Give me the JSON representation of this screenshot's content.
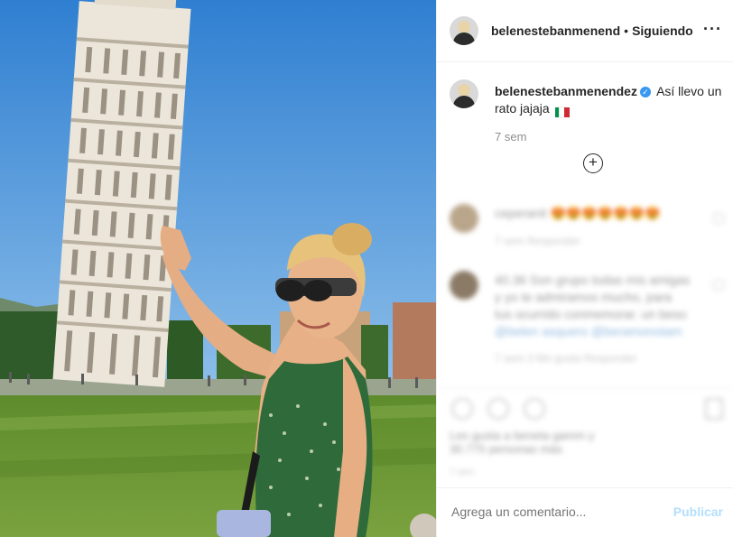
{
  "post": {
    "username_header": "belenestebanmenend",
    "dot": "•",
    "follow_label": "Siguiendo",
    "more_label": "···",
    "caption_username": "belenestebanmenendez",
    "verified_mark": "✓",
    "caption_text": "Así llevo un rato jajaja",
    "caption_flag": "Italy flag",
    "time_ago": "7 sem",
    "load_more_icon": "plus-circle-icon"
  },
  "comments_blurred": [
    {
      "line1": "ceperanit 😍😍😍😍😍😍😍",
      "meta": "7 sem   Responder"
    },
    {
      "line1": "40.36 Son grupo todas mis amigas",
      "line2": "y yo te admiramos mucho, para",
      "line3": "tus ocurrido conmemorar. un beso",
      "line4": "@belen asquero @beramonotam",
      "meta": "7 sem   3 Me gusta   Responder"
    }
  ],
  "likes_blurred": {
    "line1": "Les gusta a beneta gamm y",
    "line2": "30.775 personas más",
    "ago": "7 sem"
  },
  "add_comment": {
    "placeholder": "Agrega un comentario...",
    "publish_label": "Publicar"
  },
  "colors": {
    "verified": "#3897f0",
    "publish": "#b2dffc",
    "flag_green": "#009246",
    "flag_white": "#ffffff",
    "flag_red": "#ce2b37"
  }
}
